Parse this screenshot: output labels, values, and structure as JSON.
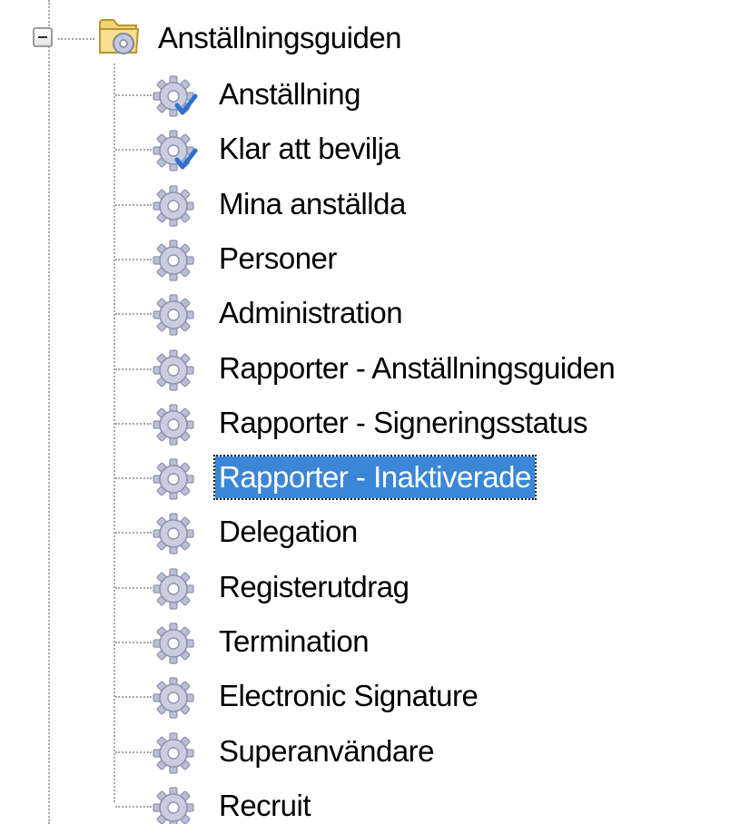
{
  "tree": {
    "root": {
      "label": "Anställningsguiden",
      "expander": "minus",
      "icon": "folder-with-gear-icon"
    },
    "items": [
      {
        "label": "Anställning",
        "icon": "gear-check-icon",
        "selected": false
      },
      {
        "label": "Klar att bevilja",
        "icon": "gear-check-icon",
        "selected": false
      },
      {
        "label": "Mina anställda",
        "icon": "gear-icon",
        "selected": false
      },
      {
        "label": "Personer",
        "icon": "gear-icon",
        "selected": false
      },
      {
        "label": "Administration",
        "icon": "gear-icon",
        "selected": false
      },
      {
        "label": "Rapporter - Anställningsguiden",
        "icon": "gear-icon",
        "selected": false
      },
      {
        "label": "Rapporter - Signeringsstatus",
        "icon": "gear-icon",
        "selected": false
      },
      {
        "label": "Rapporter - Inaktiverade",
        "icon": "gear-icon",
        "selected": true
      },
      {
        "label": "Delegation",
        "icon": "gear-icon",
        "selected": false
      },
      {
        "label": "Registerutdrag",
        "icon": "gear-icon",
        "selected": false
      },
      {
        "label": "Termination",
        "icon": "gear-icon",
        "selected": false
      },
      {
        "label": "Electronic Signature",
        "icon": "gear-icon",
        "selected": false
      },
      {
        "label": "Superanvändare",
        "icon": "gear-icon",
        "selected": false
      },
      {
        "label": "Recruit",
        "icon": "gear-icon",
        "selected": false
      }
    ]
  },
  "colors": {
    "selection_background": "#3b86d6",
    "selection_text": "#ffffff",
    "tree_lines": "#a9a9a9",
    "gear": "#b9bfd6",
    "checkmark": "#2f6fd0"
  }
}
